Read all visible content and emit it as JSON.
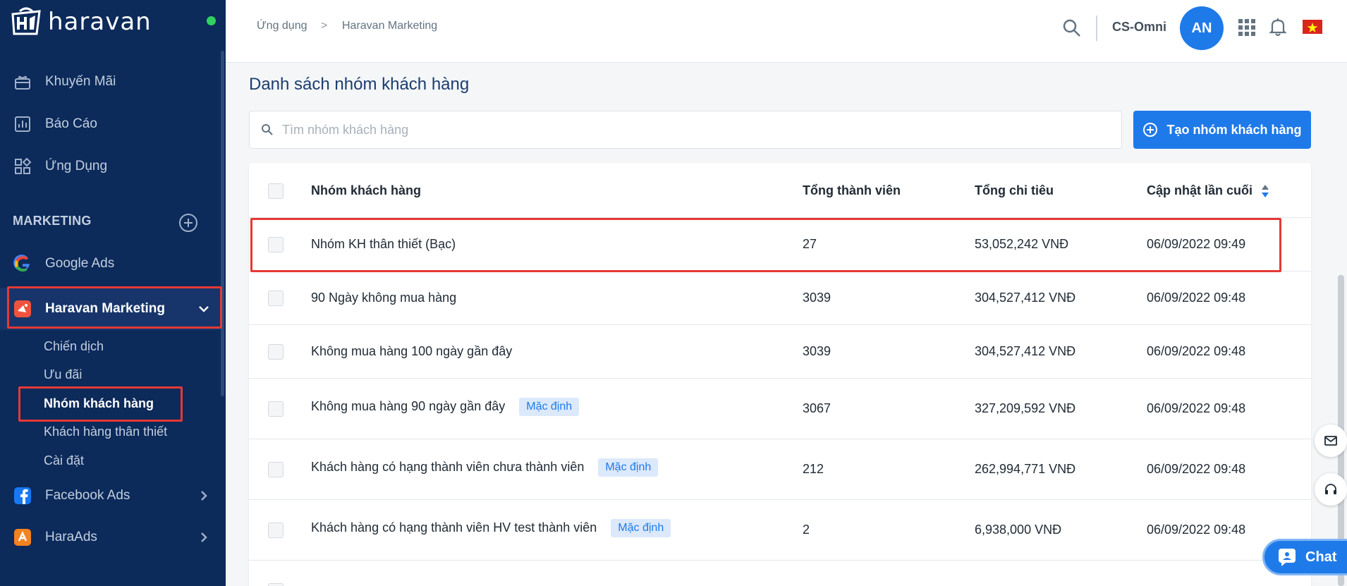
{
  "brand": {
    "logo_text": "haravan"
  },
  "sidebar": {
    "items": [
      {
        "label": "Khuyến Mãi",
        "icon": "promotion-icon"
      },
      {
        "label": "Báo Cáo",
        "icon": "report-icon"
      },
      {
        "label": "Ứng Dụng",
        "icon": "apps-grid-icon"
      }
    ],
    "section_title": "MARKETING",
    "marketing_items": [
      {
        "label": "Google Ads",
        "icon": "google-icon"
      },
      {
        "label": "Haravan Marketing",
        "icon": "haravan-marketing-icon"
      },
      {
        "label": "Facebook Ads",
        "icon": "facebook-icon"
      },
      {
        "label": "HaraAds",
        "icon": "haraads-icon"
      }
    ],
    "sub_items": [
      "Chiến dịch",
      "Ưu đãi",
      "Nhóm khách hàng",
      "Khách hàng thân thiết",
      "Cài đặt"
    ]
  },
  "topbar": {
    "breadcrumb": [
      "Ứng dụng",
      "Haravan Marketing"
    ],
    "breadcrumb_sep": ">",
    "shop_name": "CS-Omni",
    "avatar_initials": "AN"
  },
  "main": {
    "title": "Danh sách nhóm khách hàng",
    "search_placeholder": "Tìm nhóm khách hàng",
    "create_button": "Tạo nhóm khách hàng",
    "table": {
      "headers": [
        "Nhóm khách hàng",
        "Tổng thành viên",
        "Tổng chi tiêu",
        "Cập nhật lần cuối"
      ],
      "rows": [
        {
          "name": "Nhóm KH thân thiết (Bạc)",
          "badge": "",
          "members": "27",
          "spending": "53,052,242 VNĐ",
          "updated": "06/09/2022 09:49"
        },
        {
          "name": "90 Ngày không mua hàng",
          "badge": "",
          "members": "3039",
          "spending": "304,527,412 VNĐ",
          "updated": "06/09/2022 09:48"
        },
        {
          "name": "Không mua hàng 100 ngày gần đây",
          "badge": "",
          "members": "3039",
          "spending": "304,527,412 VNĐ",
          "updated": "06/09/2022 09:48"
        },
        {
          "name": "Không mua hàng 90 ngày gần đây",
          "badge": "Mặc định",
          "members": "3067",
          "spending": "327,209,592 VNĐ",
          "updated": "06/09/2022 09:48"
        },
        {
          "name": "Khách hàng có hạng thành viên chưa thành viên",
          "badge": "Mặc định",
          "members": "212",
          "spending": "262,994,771 VNĐ",
          "updated": "06/09/2022 09:48"
        },
        {
          "name": "Khách hàng có hạng thành viên HV test thành viên",
          "badge": "Mặc định",
          "members": "2",
          "spending": "6,938,000 VNĐ",
          "updated": "06/09/2022 09:48"
        }
      ]
    }
  },
  "chat": {
    "label": "Chat"
  },
  "colors": {
    "sidebar_bg": "#0c2a5a",
    "accent": "#1f7ae9",
    "highlight": "#e53935"
  }
}
